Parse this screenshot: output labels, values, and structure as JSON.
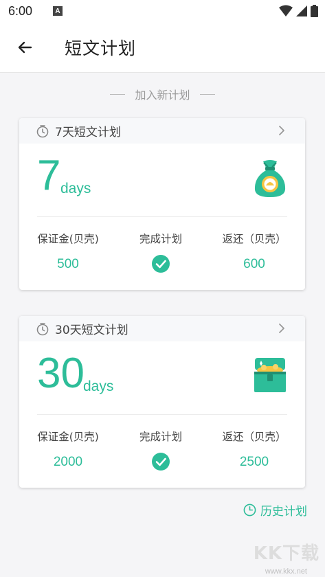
{
  "status_bar": {
    "time": "6:00",
    "a_badge": "A"
  },
  "app_bar": {
    "title": "短文计划"
  },
  "add_plan": {
    "label": "加入新计划"
  },
  "plans": [
    {
      "title": "7天短文计划",
      "number": "7",
      "unit": "days",
      "deposit_label": "保证金(贝壳)",
      "deposit_value": "500",
      "complete_label": "完成计划",
      "refund_label": "返还（贝壳）",
      "refund_value": "600",
      "illustration": "money-bag-icon"
    },
    {
      "title": "30天短文计划",
      "number": "30",
      "unit": "days",
      "deposit_label": "保证金(贝壳)",
      "deposit_value": "2000",
      "complete_label": "完成计划",
      "refund_label": "返还（贝壳）",
      "refund_value": "2500",
      "illustration": "treasure-chest-icon"
    }
  ],
  "history": {
    "label": "历史计划"
  },
  "watermark": {
    "text": "KK下载",
    "url": "www.kkx.net"
  },
  "colors": {
    "accent": "#2dbd99",
    "header_bg": "#f7f8fa",
    "page_bg": "#f5f5f7"
  }
}
